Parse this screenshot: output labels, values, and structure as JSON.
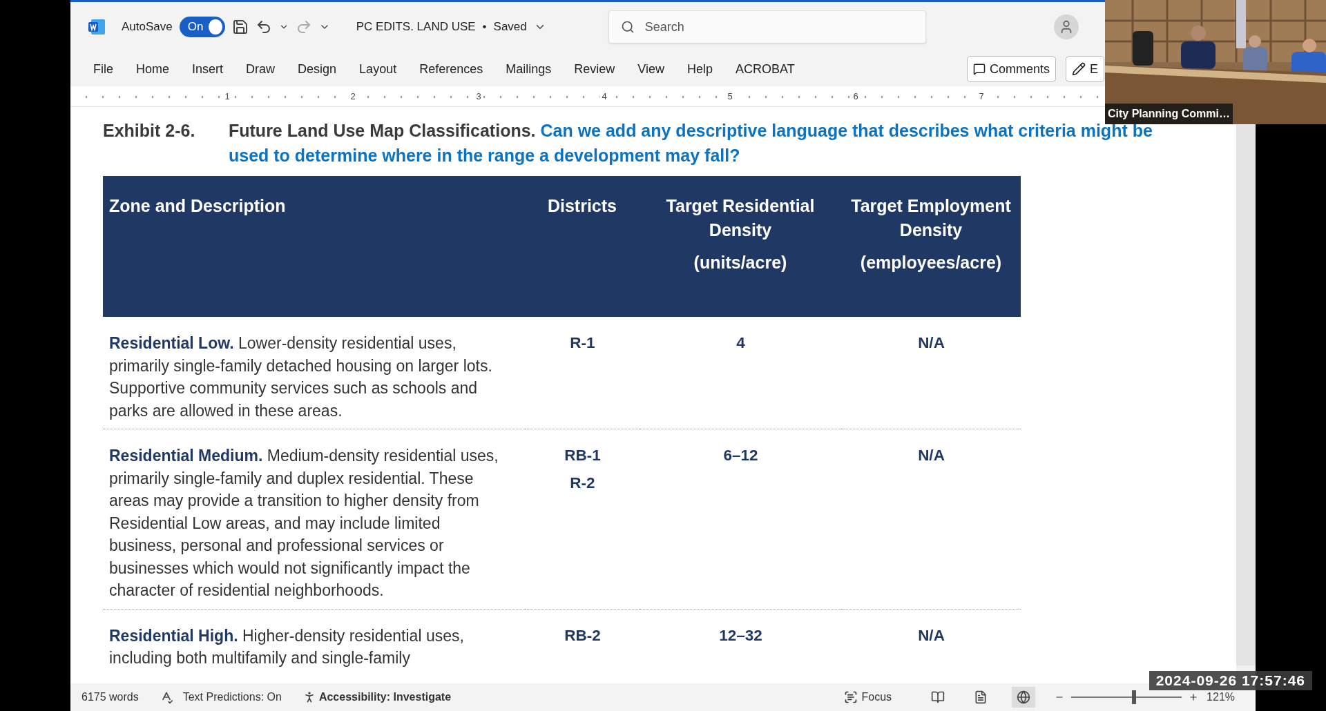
{
  "title_bar": {
    "autosave_label": "AutoSave",
    "autosave_toggle": {
      "label": "On",
      "on": true
    },
    "document_title": "PC EDITS. LAND USE",
    "separator": "•",
    "save_status": "Saved",
    "search": {
      "placeholder": "Search"
    }
  },
  "ribbon_tabs": [
    {
      "label": "File"
    },
    {
      "label": "Home"
    },
    {
      "label": "Insert"
    },
    {
      "label": "Draw"
    },
    {
      "label": "Design"
    },
    {
      "label": "Layout"
    },
    {
      "label": "References"
    },
    {
      "label": "Mailings"
    },
    {
      "label": "Review"
    },
    {
      "label": "View"
    },
    {
      "label": "Help"
    },
    {
      "label": "ACROBAT"
    }
  ],
  "ribbon_buttons": [
    {
      "kind": "comments",
      "label": "Comments"
    },
    {
      "kind": "edit",
      "label": "E"
    }
  ],
  "ruler": {
    "numbers": [
      "1",
      "2",
      "3",
      "4",
      "5",
      "6",
      "7"
    ]
  },
  "document": {
    "exhibit_label": "Exhibit 2-6.",
    "title": "Future Land Use Map Classifications.",
    "comment": "Can we add any descriptive language that describes what criteria might be used to determine where in the range a development may fall?",
    "table": {
      "columns": [
        {
          "title": "Zone and Description"
        },
        {
          "title": "Districts"
        },
        {
          "title": "Target Residential Density",
          "unit": "(units/acre)"
        },
        {
          "title": "Target Employment Density",
          "unit": "(employees/acre)"
        }
      ],
      "rows": [
        {
          "zone": "Residential Low.",
          "description": "Lower-density residential uses, primarily single-family detached housing on larger lots. Supportive community services such as schools and parks are allowed in these areas.",
          "districts": [
            "R-1"
          ],
          "residential": "4",
          "employment": "N/A"
        },
        {
          "zone": "Residential Medium.",
          "description": "Medium-density residential uses, primarily single-family and duplex residential. These areas may provide a transition to higher density from Residential Low areas, and may include limited business, personal and professional services or businesses which would not significantly impact the character of residential neighborhoods.",
          "districts": [
            "RB-1",
            "R-2"
          ],
          "residential": "6–12",
          "employment": "N/A"
        },
        {
          "zone": "Residential High.",
          "description": "Higher-density residential uses, including both multifamily and single-family",
          "districts": [
            "RB-2"
          ],
          "residential": "12–32",
          "employment": "N/A"
        }
      ]
    }
  },
  "status_bar": {
    "word_count": "6175 words",
    "text_predictions": "Text Predictions: On",
    "accessibility": "Accessibility: Investigate",
    "focus": "Focus",
    "views": [
      {
        "kind": "read",
        "selected": false
      },
      {
        "kind": "print",
        "selected": false
      },
      {
        "kind": "web",
        "selected": true
      }
    ],
    "zoom": {
      "level": 0.55,
      "label": "121%"
    }
  },
  "video_inset": {
    "kind": "picture",
    "caption": "City Planning Commi…"
  },
  "timestamp": "2024-09-26 17:57:46"
}
